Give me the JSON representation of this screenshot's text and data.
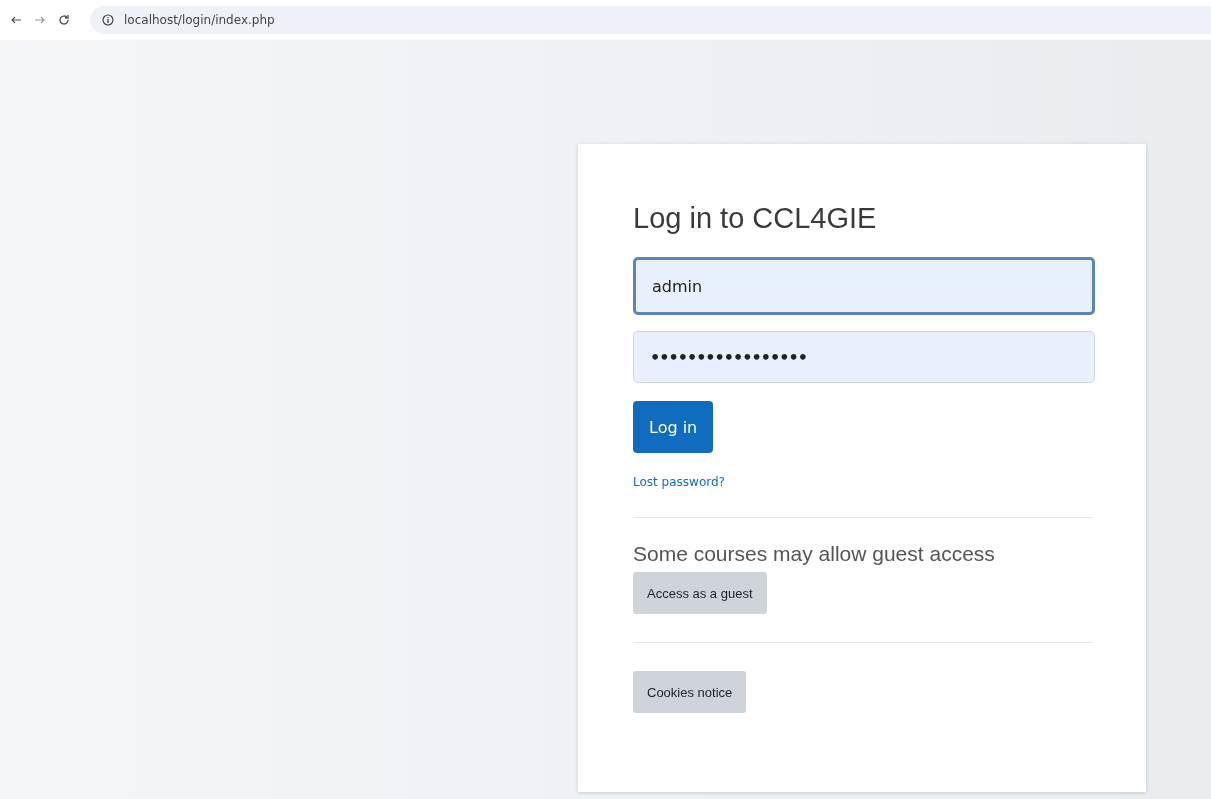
{
  "browser": {
    "url": "localhost/login/index.php"
  },
  "login": {
    "title": "Log in to CCL4GIE",
    "fields": [
      {
        "kind": "username",
        "value": "admin",
        "focused": true
      },
      {
        "kind": "password",
        "value": "•••••••••••••••••",
        "focused": false
      }
    ],
    "submit": "Log in",
    "lost_password": "Lost password?",
    "guest_heading": "Some courses may allow guest access",
    "guest_button": "Access as a guest",
    "cookies_button": "Cookies notice"
  }
}
